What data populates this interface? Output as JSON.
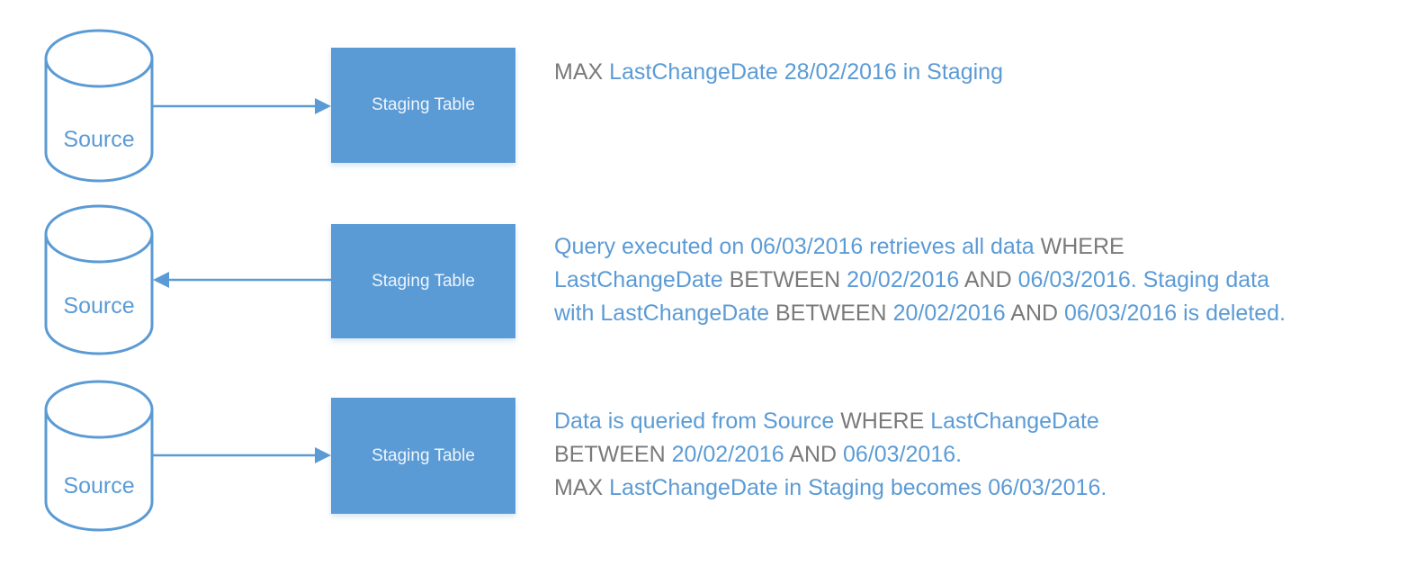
{
  "colors": {
    "shape_blue": "#5b9bd5",
    "text_blue": "#5b9bd5",
    "keyword_gray": "#7a7a7a",
    "box_text": "#eef4fb"
  },
  "steps": [
    {
      "source_label": "Source",
      "table_label": "Staging Table",
      "arrow_direction": "source-to-staging",
      "note_lines": [
        [
          {
            "text": "MAX ",
            "kw": true
          },
          {
            "text": "LastChangeDate 28/02/2016 in Staging",
            "kw": false
          }
        ]
      ]
    },
    {
      "source_label": "Source",
      "table_label": "Staging Table",
      "arrow_direction": "staging-to-source",
      "note_lines": [
        [
          {
            "text": "Query executed on 06/03/2016 retrieves all data ",
            "kw": false
          },
          {
            "text": "WHERE",
            "kw": true
          }
        ],
        [
          {
            "text": "LastChangeDate ",
            "kw": false
          },
          {
            "text": "BETWEEN ",
            "kw": true
          },
          {
            "text": "20/02/2016 ",
            "kw": false
          },
          {
            "text": "AND ",
            "kw": true
          },
          {
            "text": "06/03/2016. Staging data",
            "kw": false
          }
        ],
        [
          {
            "text": "with LastChangeDate ",
            "kw": false
          },
          {
            "text": "BETWEEN ",
            "kw": true
          },
          {
            "text": "20/02/2016 ",
            "kw": false
          },
          {
            "text": "AND ",
            "kw": true
          },
          {
            "text": "06/03/2016 is deleted.",
            "kw": false
          }
        ]
      ]
    },
    {
      "source_label": "Source",
      "table_label": "Staging Table",
      "arrow_direction": "source-to-staging",
      "note_lines": [
        [
          {
            "text": "Data is queried from Source ",
            "kw": false
          },
          {
            "text": "WHERE ",
            "kw": true
          },
          {
            "text": "LastChangeDate",
            "kw": false
          }
        ],
        [
          {
            "text": "BETWEEN ",
            "kw": true
          },
          {
            "text": "20/02/2016 ",
            "kw": false
          },
          {
            "text": "AND ",
            "kw": true
          },
          {
            "text": "06/03/2016.",
            "kw": false
          }
        ],
        [
          {
            "text": "MAX ",
            "kw": true
          },
          {
            "text": "LastChangeDate in Staging becomes 06/03/2016.",
            "kw": false
          }
        ]
      ]
    }
  ]
}
